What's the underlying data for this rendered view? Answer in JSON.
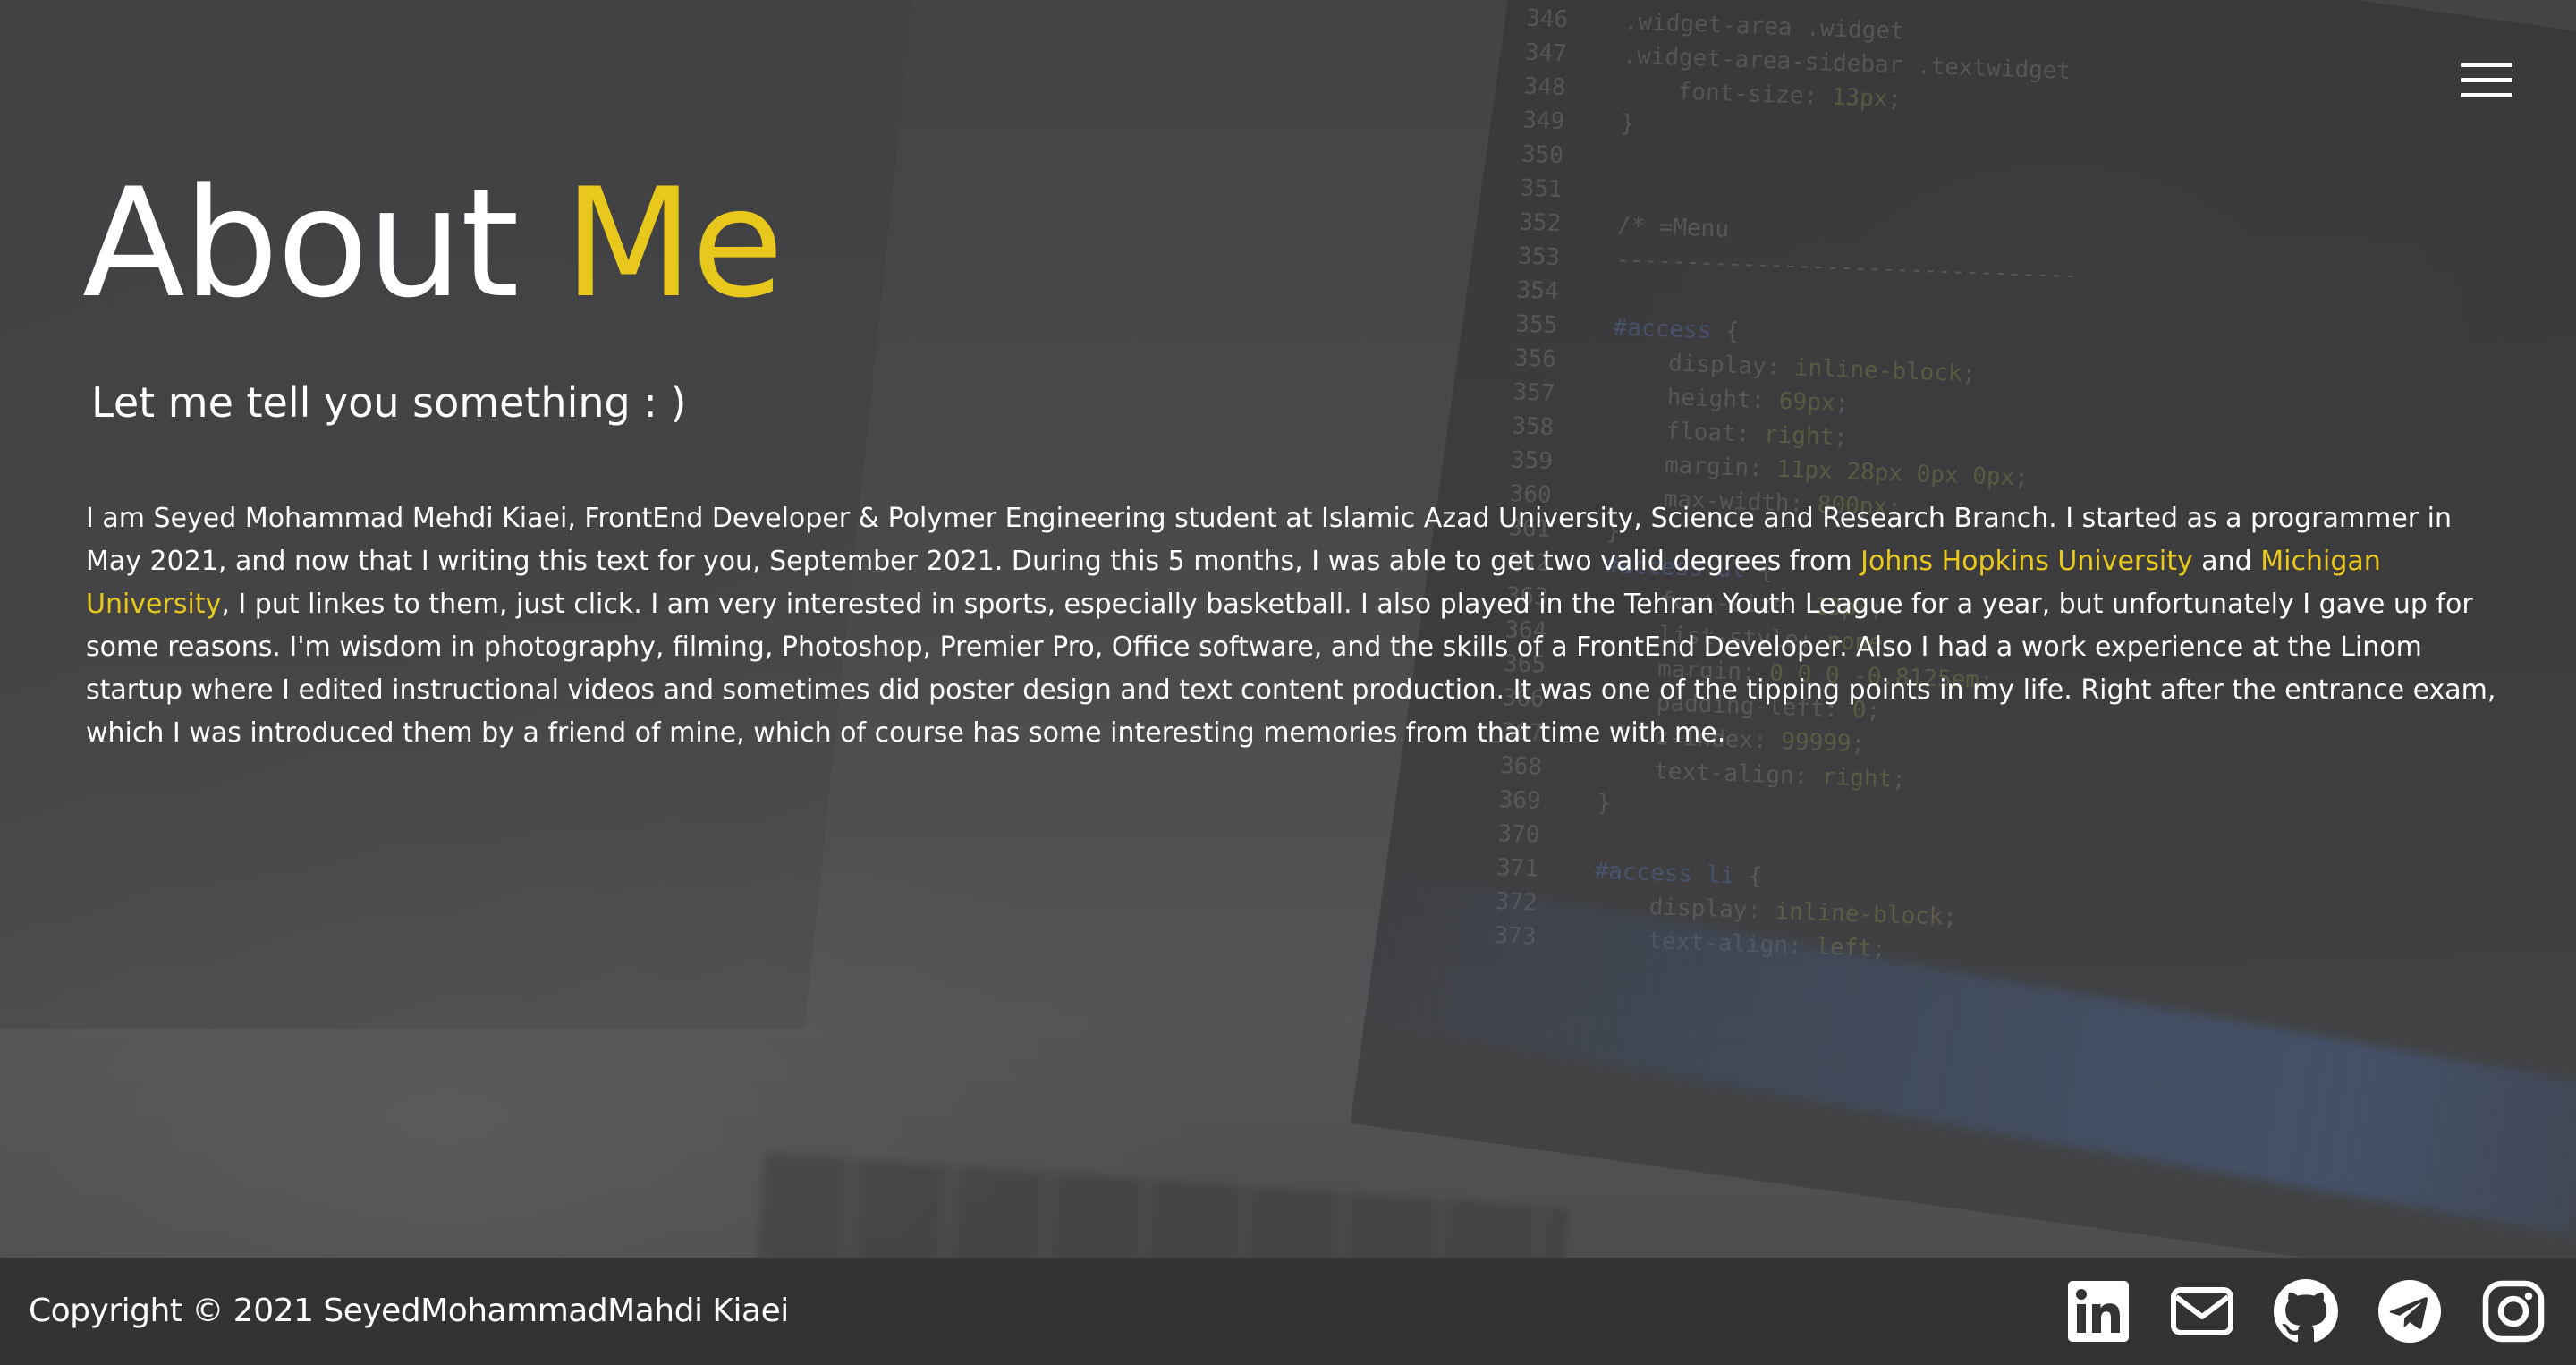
{
  "header": {
    "menu_icon": "hamburger-menu-icon"
  },
  "about": {
    "title_main": "About",
    "title_accent": "Me",
    "subtitle": "Let me tell you something : )",
    "bio": {
      "part1": "I am Seyed Mohammad Mehdi Kiaei, FrontEnd Developer & Polymer Engineering student at Islamic Azad University, Science and Research Branch. I started as a programmer in May 2021, and now that I writing this text for you, September 2021. During this 5 months, I was able to get two valid degrees from ",
      "link1": "Johns Hopkins University",
      "part2": " and ",
      "link2": "Michigan University",
      "part3": ", I put linkes to them, just click. I am very interested in sports, especially basketball. I also played in the Tehran Youth League for a year, but unfortunately I gave up for some reasons. I'm wisdom in photography, filming, Photoshop, Premier Pro, Office software, and the skills of a FrontEnd Developer. Also I had a work experience at the Linom startup where I edited instructional videos and sometimes did poster design and text content production. It was one of the tipping points in my life. Right after the entrance exam, which I was introduced them by a friend of mine, which of course has some interesting memories from that time with me."
    },
    "accent_color": "#e8c81c"
  },
  "footer": {
    "copyright": "Copyright © 2021 SeyedMohammadMahdi Kiaei",
    "socials": [
      {
        "icon": "linkedin-icon"
      },
      {
        "icon": "email-icon"
      },
      {
        "icon": "github-icon"
      },
      {
        "icon": "telegram-icon"
      },
      {
        "icon": "instagram-icon"
      }
    ],
    "background": "#333334"
  }
}
